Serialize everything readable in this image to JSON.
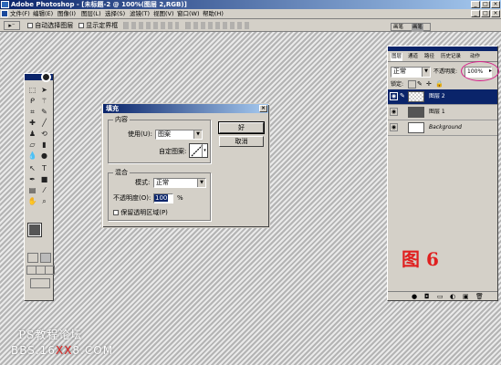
{
  "app": {
    "title": "Adobe Photoshop - [未标题-2 @ 100%(图层 2,RGB)]"
  },
  "menubar": {
    "items": [
      "文件(F)",
      "编辑(E)",
      "图像(I)",
      "图层(L)",
      "选择(S)",
      "滤镜(T)",
      "视图(V)",
      "窗口(W)",
      "帮助(H)"
    ]
  },
  "options": {
    "auto_select_label": "自动选择图层",
    "show_bounds_label": "显示定界框"
  },
  "dialog": {
    "title": "填充",
    "ok_label": "好",
    "cancel_label": "取消",
    "content_group_label": "内容",
    "use_label": "使用(U):",
    "use_value": "图案",
    "custom_pattern_label": "自定图案:",
    "blend_group_label": "混合",
    "mode_label": "模式:",
    "mode_value": "正常",
    "opacity_label": "不透明度(O):",
    "opacity_value": "100",
    "opacity_unit": "%",
    "preserve_label": "保留透明区域(P)"
  },
  "layers": {
    "tabs": [
      "图层",
      "通道",
      "路径",
      "历史记录",
      "动作"
    ],
    "blend_mode": "正常",
    "opacity_label": "不透明度:",
    "opacity_value": "100%",
    "lock_label": "锁定:",
    "rows": [
      {
        "name": "图层 2",
        "selected": true
      },
      {
        "name": "图层 1",
        "selected": false
      },
      {
        "name": "Background",
        "selected": false
      }
    ]
  },
  "figure_label": "图 6",
  "watermark": {
    "line1": "PS教程论坛",
    "line2_a": "BBS.16",
    "line2_b": "XX",
    "line2_c": "8.COM"
  },
  "colors": {
    "title_bar": "#0a246a",
    "selected_layer": "#0a246a",
    "accent_red": "#e02020"
  }
}
